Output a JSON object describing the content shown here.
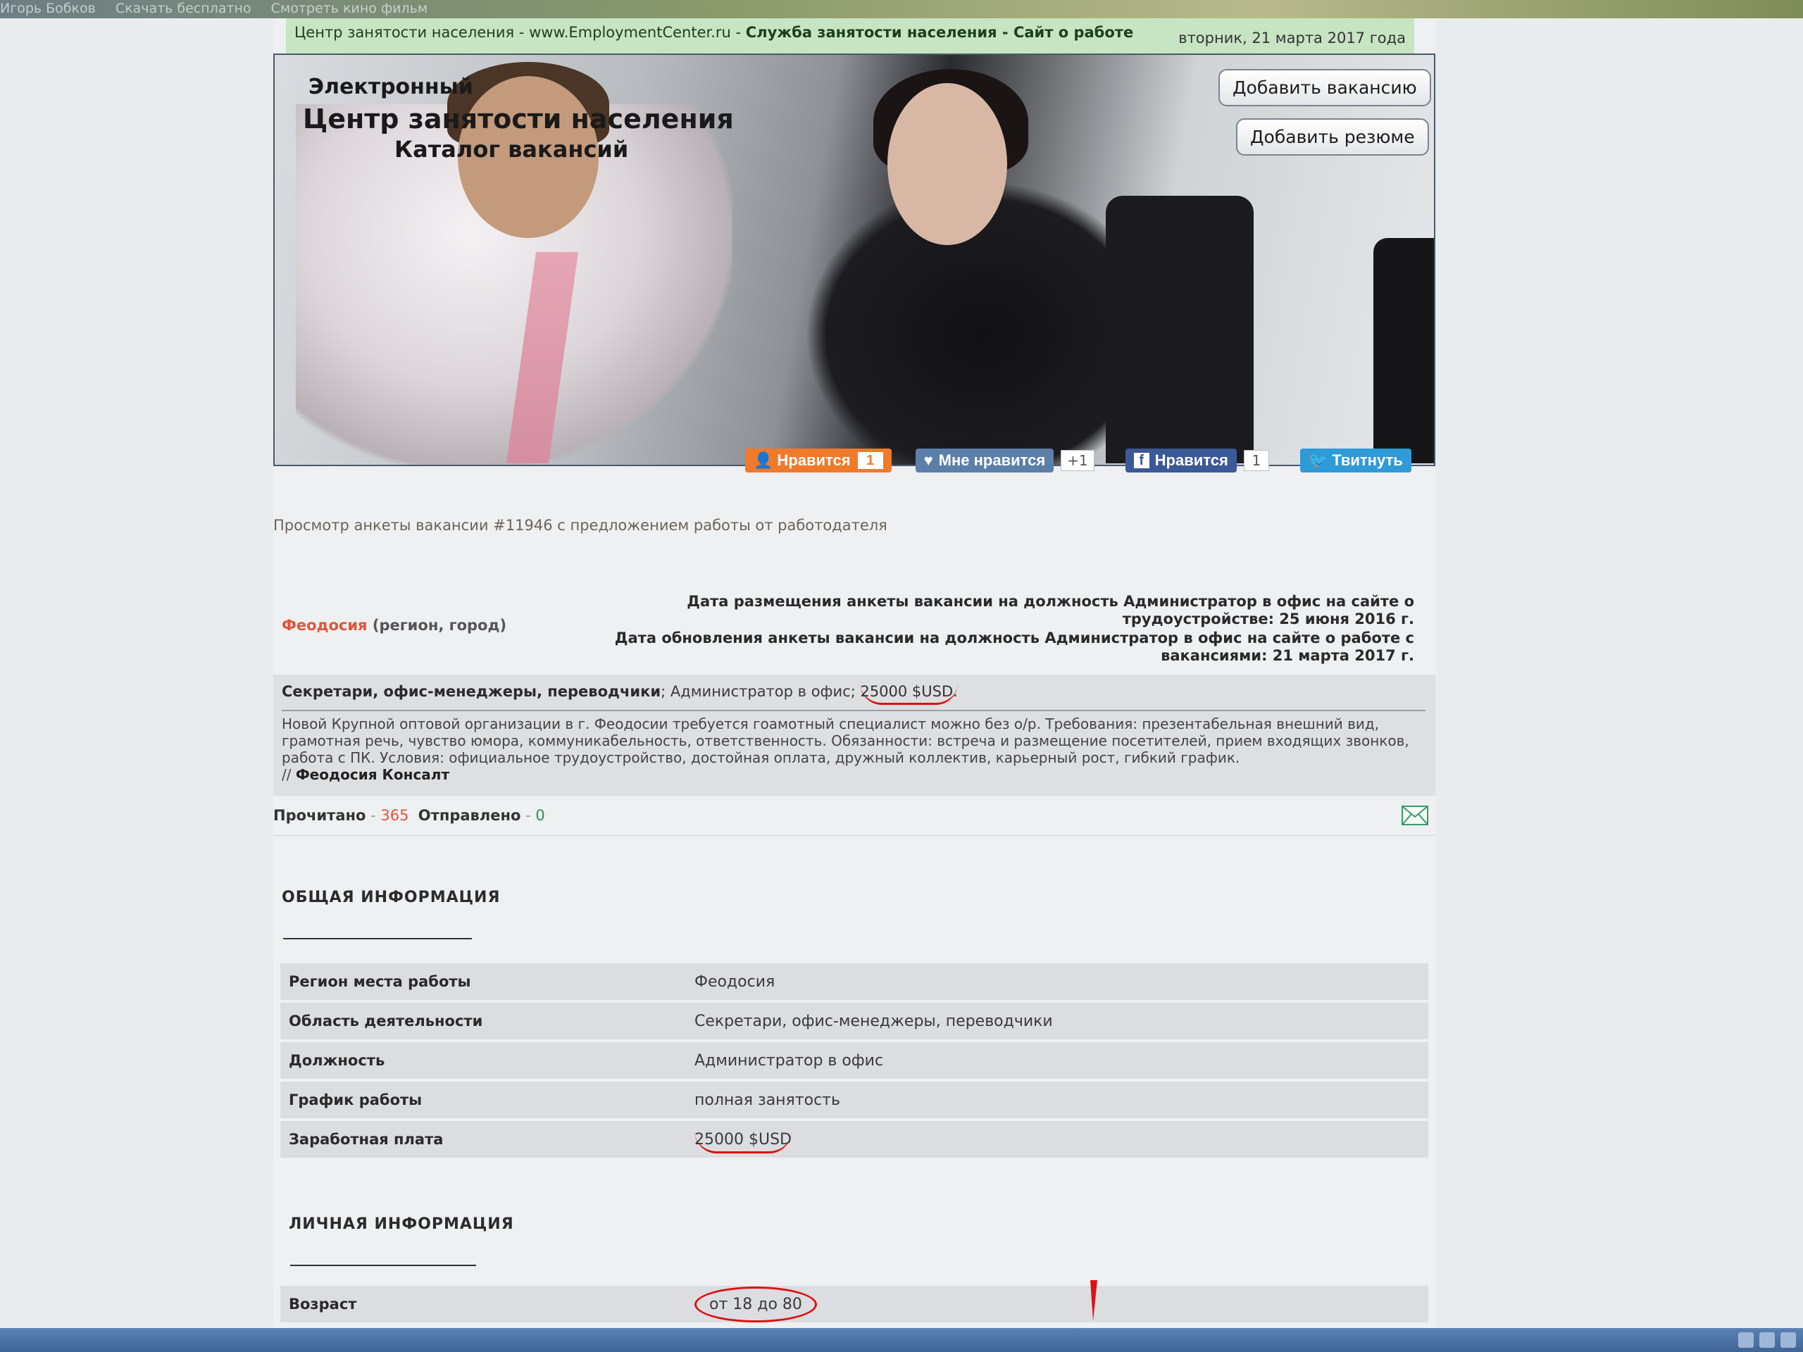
{
  "os": {
    "top_strip_items": [
      "Игорь Бобков",
      "Скачать бесплатно",
      "Смотреть кино фильм"
    ]
  },
  "header": {
    "title_plain": "Центр занятости населения - www.EmploymentCenter.ru - ",
    "title_bold": "Служба занятости населения - Сайт о работе",
    "date": "вторник, 21 марта 2017 года"
  },
  "banner": {
    "line1": "Электронный",
    "line2": "Центр занятости населения",
    "line3": "Каталог вакансий",
    "add_vacancy": "Добавить вакансию",
    "add_resume": "Добавить резюме"
  },
  "social": {
    "ok_label": "Нравится",
    "ok_count": "1",
    "vk_label": "Мне нравится",
    "vk_count": "+1",
    "fb_label": "Нравится",
    "fb_count": "1",
    "tw_label": "Твитнуть"
  },
  "breadcrumb": "Просмотр анкеты вакансии #11946 с предложением работы от работодателя",
  "pub": {
    "city": "Феодосия",
    "city_suffix": " (регион, город)",
    "posted": "Дата размещения анкеты вакансии на должность Администратор в офис на сайте о трудоустройстве: 25 июня 2016 г.",
    "updated": "Дата обновления анкеты вакансии на должность Администратор в офис на сайте о работе с вакансиями: 21 марта 2017 г."
  },
  "summary": {
    "category": "Секретари, офис-менеджеры, переводчики",
    "position": "; Администратор в офис; ",
    "salary": "25000 $USD.",
    "description": "Новой Крупной оптовой организации в г. Феодосии требуется гоамотный специалист можно без о/р. Требования: презентабельная внешний вид, грамотная речь, чувство юмора, коммуникабельность, ответственность. Обязанности: встреча и размещение посетителей, прием входящих звонков, работа с ПК. Условия: официальное трудоустройство, достойная оплата, дружный коллектив, карьерный рост, гибкий график.",
    "company_prefix": "// ",
    "company": "Феодосия Консалт"
  },
  "stats": {
    "read_label": "Прочитано",
    "read_count": "365",
    "sent_label": "Отправлено",
    "sent_count": "0",
    "dash": " - "
  },
  "general": {
    "title": "ОБЩАЯ ИНФОРМАЦИЯ",
    "rows": [
      {
        "key": "Регион места работы",
        "value": "Феодосия"
      },
      {
        "key": "Область деятельности",
        "value": "Секретари, офис-менеджеры, переводчики"
      },
      {
        "key": "Должность",
        "value": "Администратор в офис"
      },
      {
        "key": "График работы",
        "value": "полная занятость"
      },
      {
        "key": "Заработная плата",
        "value": "25000 $USD"
      }
    ]
  },
  "personal": {
    "title": "ЛИЧНАЯ ИНФОРМАЦИЯ",
    "rows": [
      {
        "key": "Возраст",
        "value": "от 18 до 80"
      }
    ]
  },
  "colors": {
    "accent_red": "#e0553c",
    "header_green": "#c7e4c3",
    "annotation_red": "#dd1111"
  }
}
